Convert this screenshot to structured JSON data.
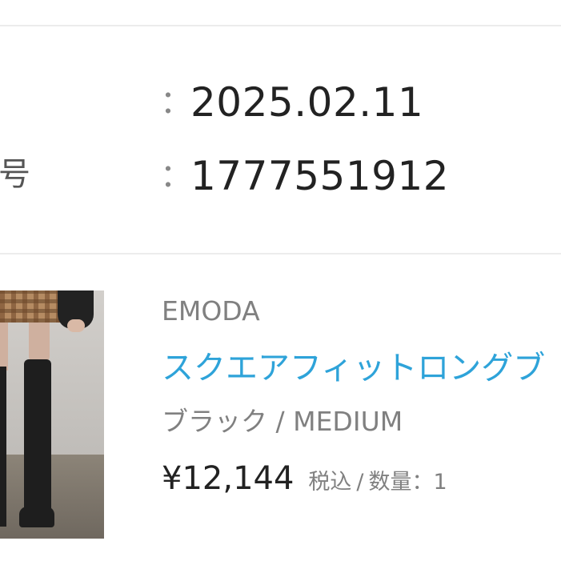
{
  "order_info": {
    "order_number_label_fragment": "号",
    "colon": "：",
    "date_value": "2025.02.11",
    "order_number_value": "1777551912"
  },
  "product": {
    "brand": "EMODA",
    "name": "スクエアフィットロングブ",
    "variant": "ブラック / MEDIUM",
    "price": "¥12,144",
    "tax_label": "税込",
    "separator": "/",
    "quantity_label": "数量：1"
  }
}
